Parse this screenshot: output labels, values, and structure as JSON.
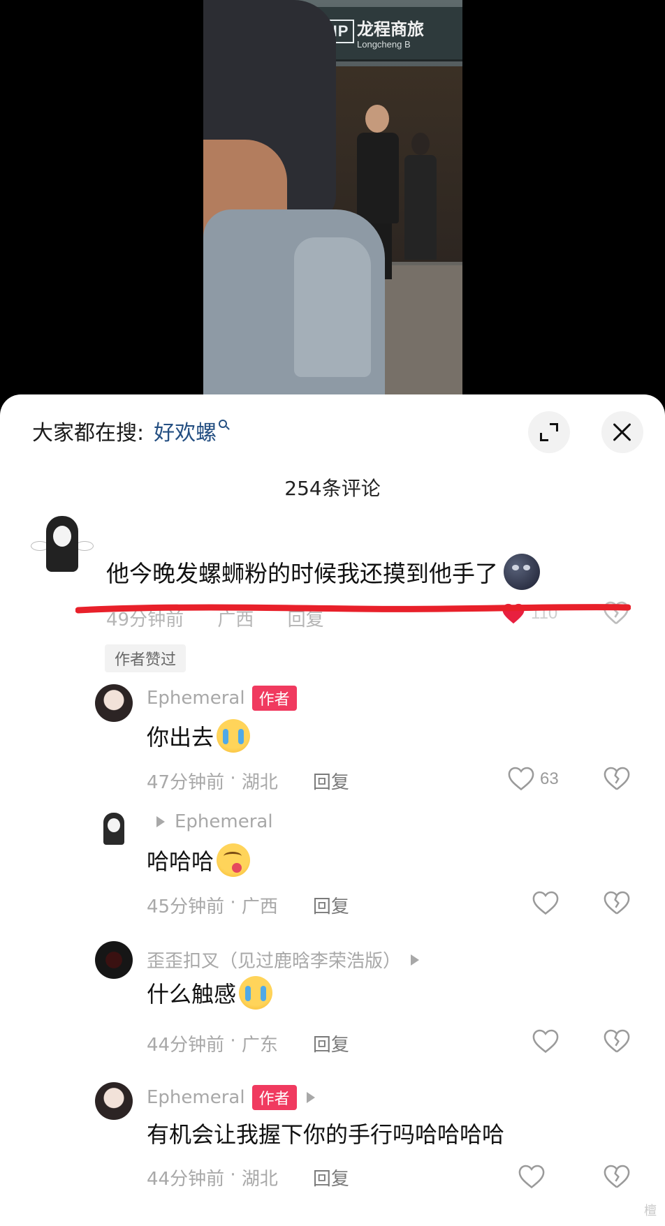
{
  "video": {
    "sign_vip": "VIP",
    "sign_cn": "龙程商旅",
    "sign_en": "Longcheng B"
  },
  "header": {
    "hot_search_label": "大家都在搜:",
    "hot_search_keyword": "好欢螺",
    "expand_icon": "expand-icon",
    "close_icon": "close-icon"
  },
  "comment_count": "254条评论",
  "top_comment": {
    "text": "他今晚发螺蛳粉的时候我还摸到他手了",
    "time": "49分钟前",
    "location": "广西",
    "reply_label": "回复",
    "like_count": "110",
    "author_liked": "作者赞过",
    "strike_color": "#e8202a"
  },
  "replies": [
    {
      "name": "Ephemeral",
      "badge": "作者",
      "text": "你出去",
      "time": "47分钟前",
      "location": "湖北",
      "reply_label": "回复",
      "like_count": "63"
    },
    {
      "name": "",
      "reply_to": "Ephemeral",
      "text": "哈哈哈",
      "time": "45分钟前",
      "location": "广西",
      "reply_label": "回复",
      "like_count": ""
    },
    {
      "name": "歪歪扣叉（见过鹿晗李荣浩版）",
      "text": "什么触感",
      "time": "44分钟前",
      "location": "广东",
      "reply_label": "回复",
      "like_count": ""
    },
    {
      "name": "Ephemeral",
      "badge": "作者",
      "text": "有机会让我握下你的手行吗哈哈哈哈",
      "time": "44分钟前",
      "location": "湖北",
      "reply_label": "回复",
      "like_count": ""
    }
  ],
  "colors": {
    "author_badge": "#f03a5f",
    "keyword_link": "#244f82",
    "liked_heart": "#e8203f"
  },
  "watermark": "檀"
}
